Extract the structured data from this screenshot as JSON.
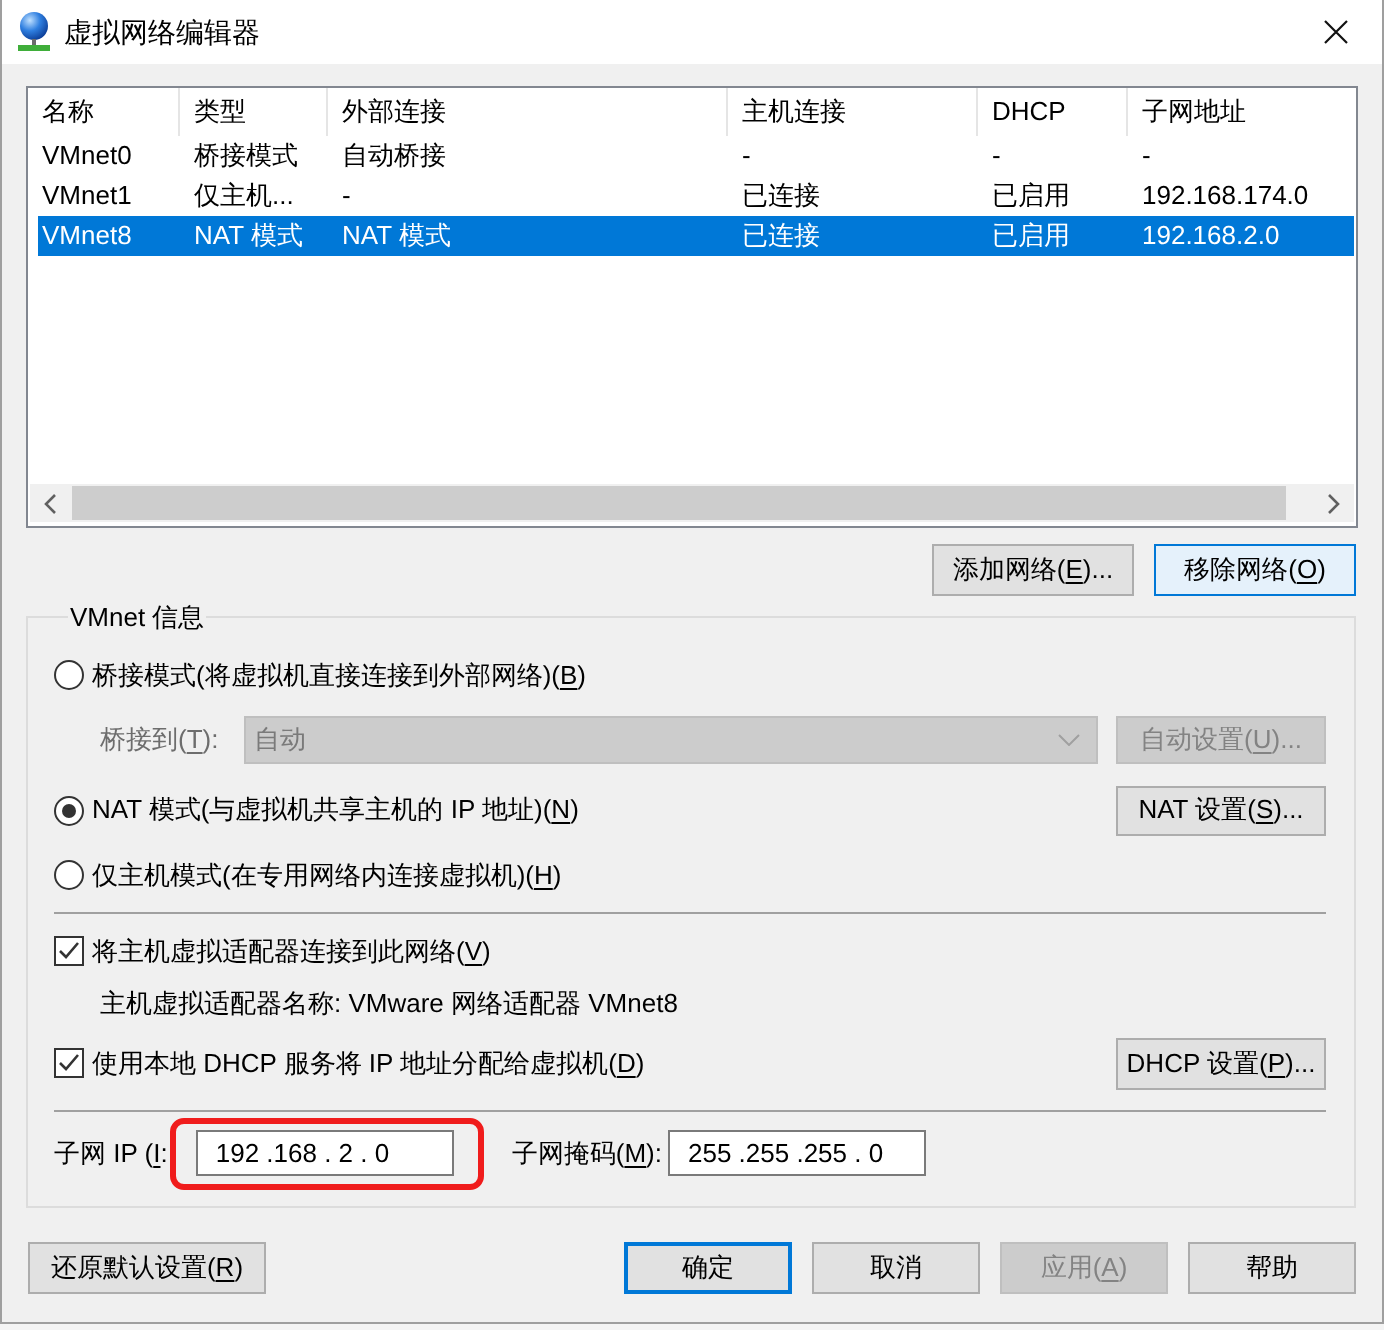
{
  "window": {
    "title": "虚拟网络编辑器"
  },
  "network_table": {
    "columns": [
      "名称",
      "类型",
      "外部连接",
      "主机连接",
      "DHCP",
      "子网地址"
    ],
    "rows": [
      {
        "cells": [
          "VMnet0",
          "桥接模式",
          "自动桥接",
          "-",
          "-",
          "-"
        ],
        "selected": false
      },
      {
        "cells": [
          "VMnet1",
          "仅主机...",
          "-",
          "已连接",
          "已启用",
          "192.168.174.0"
        ],
        "selected": false
      },
      {
        "cells": [
          "VMnet8",
          "NAT 模式",
          "NAT 模式",
          "已连接",
          "已启用",
          "192.168.2.0"
        ],
        "selected": true
      }
    ]
  },
  "table_buttons": [
    {
      "label": {
        "before": "添加网络(",
        "key": "E",
        "after": ")..."
      },
      "hovered": false
    },
    {
      "label": {
        "before": "移除网络(",
        "key": "O",
        "after": ")"
      },
      "hovered": true
    }
  ],
  "vmnet_info": {
    "title": "VMnet 信息",
    "modes": [
      {
        "label": {
          "before": "桥接模式(将虚拟机直接连接到外部网络)(",
          "key": "B",
          "after": ")"
        },
        "selected": false,
        "bridge_to": {
          "label": {
            "before": "桥接到(",
            "key": "T",
            "after": "):"
          },
          "value": "自动",
          "disabled": true,
          "button": {
            "label": {
              "before": "自动设置(",
              "key": "U",
              "after": ")..."
            },
            "disabled": true
          }
        }
      },
      {
        "label": {
          "before": "NAT 模式(与虚拟机共享主机的 IP 地址)(",
          "key": "N",
          "after": ")"
        },
        "selected": true,
        "button": {
          "label": {
            "before": "NAT 设置(",
            "key": "S",
            "after": ")..."
          },
          "disabled": false
        }
      },
      {
        "label": {
          "before": "仅主机模式(在专用网络内连接虚拟机)(",
          "key": "H",
          "after": ")"
        },
        "selected": false
      }
    ],
    "options": [
      {
        "label": {
          "before": "将主机虚拟适配器连接到此网络(",
          "key": "V",
          "after": ")"
        },
        "checked": true,
        "note": "主机虚拟适配器名称: VMware 网络适配器 VMnet8"
      },
      {
        "label": {
          "before": "使用本地 DHCP 服务将 IP 地址分配给虚拟机(",
          "key": "D",
          "after": ")"
        },
        "checked": true,
        "button": {
          "label": {
            "before": "DHCP 设置(",
            "key": "P",
            "after": ")..."
          },
          "disabled": false
        }
      }
    ],
    "subnet_ip": {
      "label": {
        "before": "子网 IP (",
        "key": "I",
        "after": ":"
      },
      "value": "192 .168 . 2 . 0",
      "highlighted": true
    },
    "subnet_mask": {
      "label": {
        "before": "子网掩码(",
        "key": "M",
        "after": "):"
      },
      "value": "255 .255 .255 . 0"
    }
  },
  "footer": {
    "restore_button": {
      "label": {
        "before": "还原默认设置(",
        "key": "R",
        "after": ")"
      }
    },
    "buttons": [
      {
        "label": "确定",
        "default": true,
        "disabled": false
      },
      {
        "label": "取消",
        "default": false,
        "disabled": false
      },
      {
        "label": {
          "before": "应用(",
          "key": "A",
          "after": ")"
        },
        "default": false,
        "disabled": true
      },
      {
        "label": "帮助",
        "default": false,
        "disabled": false
      }
    ]
  }
}
